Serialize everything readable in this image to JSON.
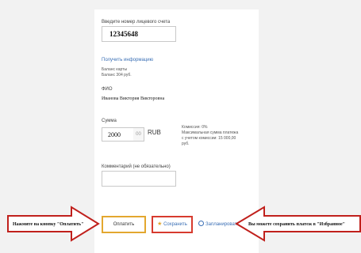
{
  "form": {
    "account_label": "Введите номер лицевого счета",
    "account_value": "12345648",
    "info_link": "Получить информацию",
    "balance_label": "Баланс карты",
    "balance_value": "Баланс 304 руб.",
    "fio_label": "ФИО",
    "fio_value": "Иванова Виктория Викторовна",
    "sum_label": "Сумма",
    "sum_value": "2000",
    "sum_suffix": "00",
    "currency": "RUB",
    "commission_line1": "Комиссия: 0%",
    "commission_line2": "Максимальная сумма платежа",
    "commission_line3": "с учетом комиссии: 15 000,00",
    "commission_line4": "руб.",
    "comment_label": "Комментарий (не обязательно)"
  },
  "actions": {
    "pay_label": "Оплатить",
    "save_label": "Сохранить",
    "remember_label": "Запланировать"
  },
  "callouts": {
    "left_text": "Нажмите на кнопку \"Оплатить\"",
    "right_text": "Вы можете сохранить платеж в \"Избранное\""
  },
  "colors": {
    "arrow_stroke": "#c0201c",
    "pay_border": "#e3a72f",
    "save_border": "#d73b2e",
    "link": "#3a6fb5"
  }
}
